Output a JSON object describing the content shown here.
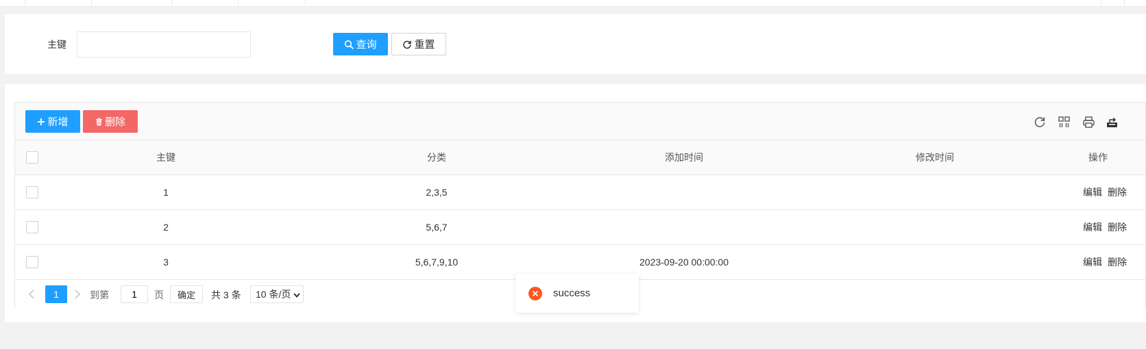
{
  "search": {
    "field_label": "主键",
    "input_value": "",
    "query_label": "查询",
    "reset_label": "重置"
  },
  "toolbar": {
    "add_label": "新增",
    "delete_label": "删除",
    "icons": [
      "refresh-icon",
      "columns-icon",
      "print-icon",
      "export-icon"
    ]
  },
  "table": {
    "columns": [
      "主键",
      "分类",
      "添加时间",
      "修改时间",
      "操作"
    ],
    "rows": [
      {
        "id": "1",
        "category": "2,3,5",
        "created": "",
        "modified": ""
      },
      {
        "id": "2",
        "category": "5,6,7",
        "created": "",
        "modified": ""
      },
      {
        "id": "3",
        "category": "5,6,7,9,10",
        "created": "2023-09-20 00:00:00",
        "modified": ""
      }
    ],
    "row_actions": {
      "edit": "编辑",
      "delete": "删除"
    }
  },
  "pagination": {
    "current_page": "1",
    "goto_label": "到第",
    "goto_value": "1",
    "page_suffix": "页",
    "confirm_label": "确定",
    "total_text": "共 3 条",
    "page_size": "10 条/页"
  },
  "toast": {
    "message": "success",
    "status": "error"
  },
  "colors": {
    "primary": "#1e9fff",
    "danger": "#f46767",
    "toast_icon": "#ff5722"
  }
}
